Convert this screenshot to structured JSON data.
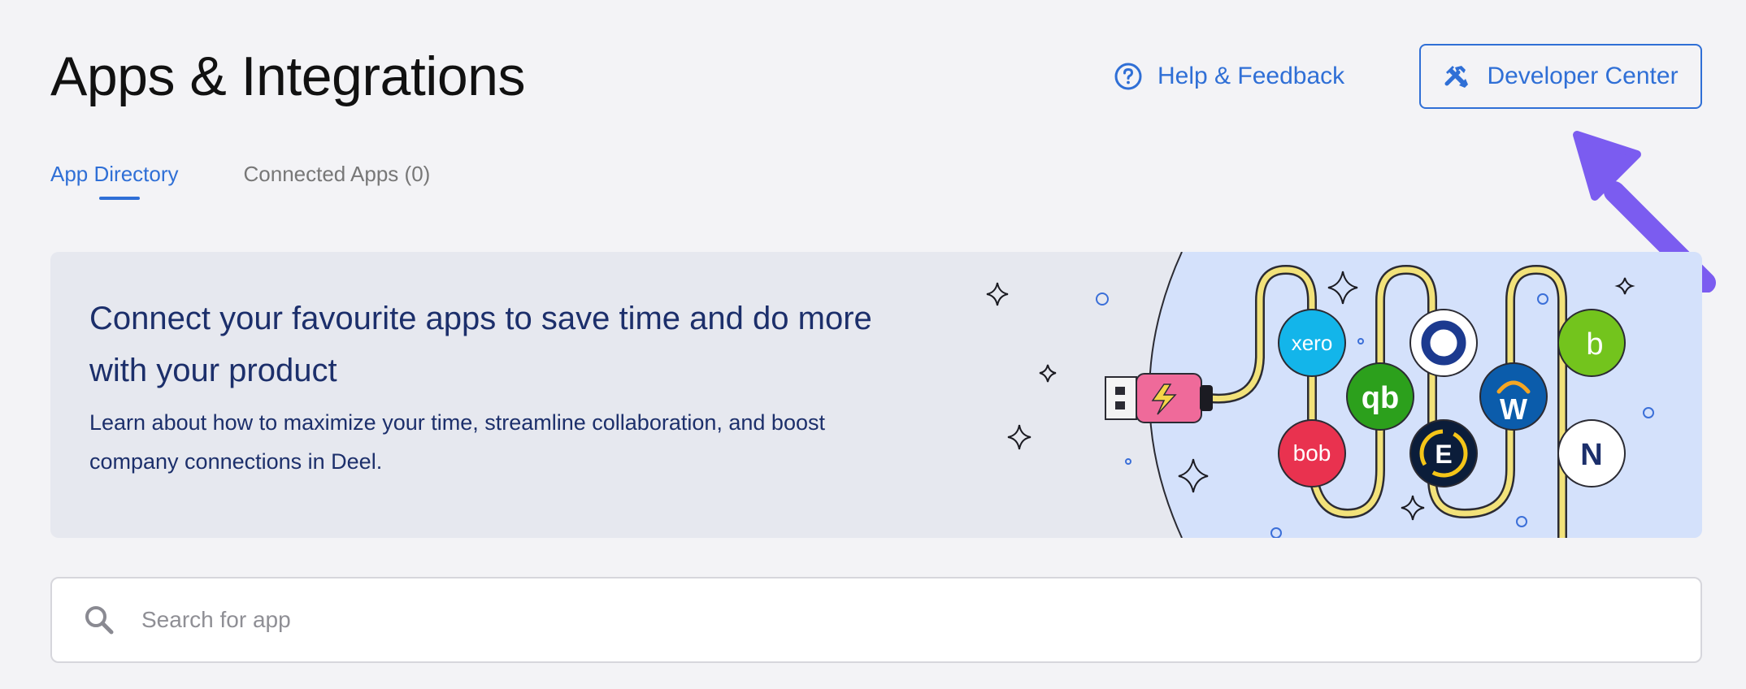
{
  "header": {
    "title": "Apps & Integrations",
    "help_label": "Help & Feedback",
    "developer_center_label": "Developer Center"
  },
  "tabs": [
    {
      "label": "App Directory",
      "active": true
    },
    {
      "label": "Connected Apps (0)",
      "active": false
    }
  ],
  "banner": {
    "heading": "Connect your favourite apps to save time and do more with your product",
    "body": "Learn about how to maximize your time, streamline collaboration, and boost company connections in Deel.",
    "app_logos": [
      {
        "name": "xero",
        "label": "xero",
        "color": "#13b5ea"
      },
      {
        "name": "quickbooks",
        "label": "qb",
        "color": "#2ca01c"
      },
      {
        "name": "bob",
        "label": "bob",
        "color": "#e9324f"
      },
      {
        "name": "workday",
        "label": "W",
        "color": "#0b5cab"
      },
      {
        "name": "bamboohr",
        "label": "b",
        "color": "#73c41d"
      },
      {
        "name": "expensify",
        "label": "E",
        "color": "#0b1d3a"
      },
      {
        "name": "namely",
        "label": "N",
        "color": "#1c2f6b"
      }
    ]
  },
  "search": {
    "placeholder": "Search for app",
    "value": ""
  },
  "colors": {
    "accent": "#2f6fd6",
    "banner_text": "#1c2f6b",
    "annotation_arrow": "#7b5cf0"
  }
}
